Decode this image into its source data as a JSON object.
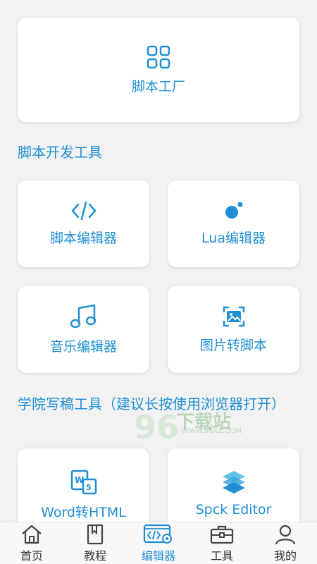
{
  "factory": {
    "label": "脚本工厂",
    "icon": "grid-icon"
  },
  "sections": {
    "dev_tools_title": "脚本开发工具",
    "writing_tools_title": "学院写稿工具（建议长按使用浏览器打开）"
  },
  "dev_tools": [
    {
      "label": "脚本编辑器",
      "icon": "code-icon"
    },
    {
      "label": "Lua编辑器",
      "icon": "lua-icon"
    },
    {
      "label": "音乐编辑器",
      "icon": "music-note-icon"
    },
    {
      "label": "图片转脚本",
      "icon": "image-scan-icon"
    }
  ],
  "writing_tools": [
    {
      "label": "Word转HTML",
      "icon": "word-html-icon"
    },
    {
      "label": "Spck Editor",
      "icon": "spck-logo-icon"
    }
  ],
  "watermark": {
    "text": "下载站",
    "sub": "WWW.96XZ.COM"
  },
  "nav": [
    {
      "label": "首页",
      "icon": "home-icon"
    },
    {
      "label": "教程",
      "icon": "book-icon"
    },
    {
      "label": "编辑器",
      "icon": "editor-icon",
      "active": true
    },
    {
      "label": "工具",
      "icon": "toolbox-icon"
    },
    {
      "label": "我的",
      "icon": "user-icon"
    }
  ],
  "colors": {
    "accent": "#1e8fd6",
    "background": "#f2f2f2"
  }
}
